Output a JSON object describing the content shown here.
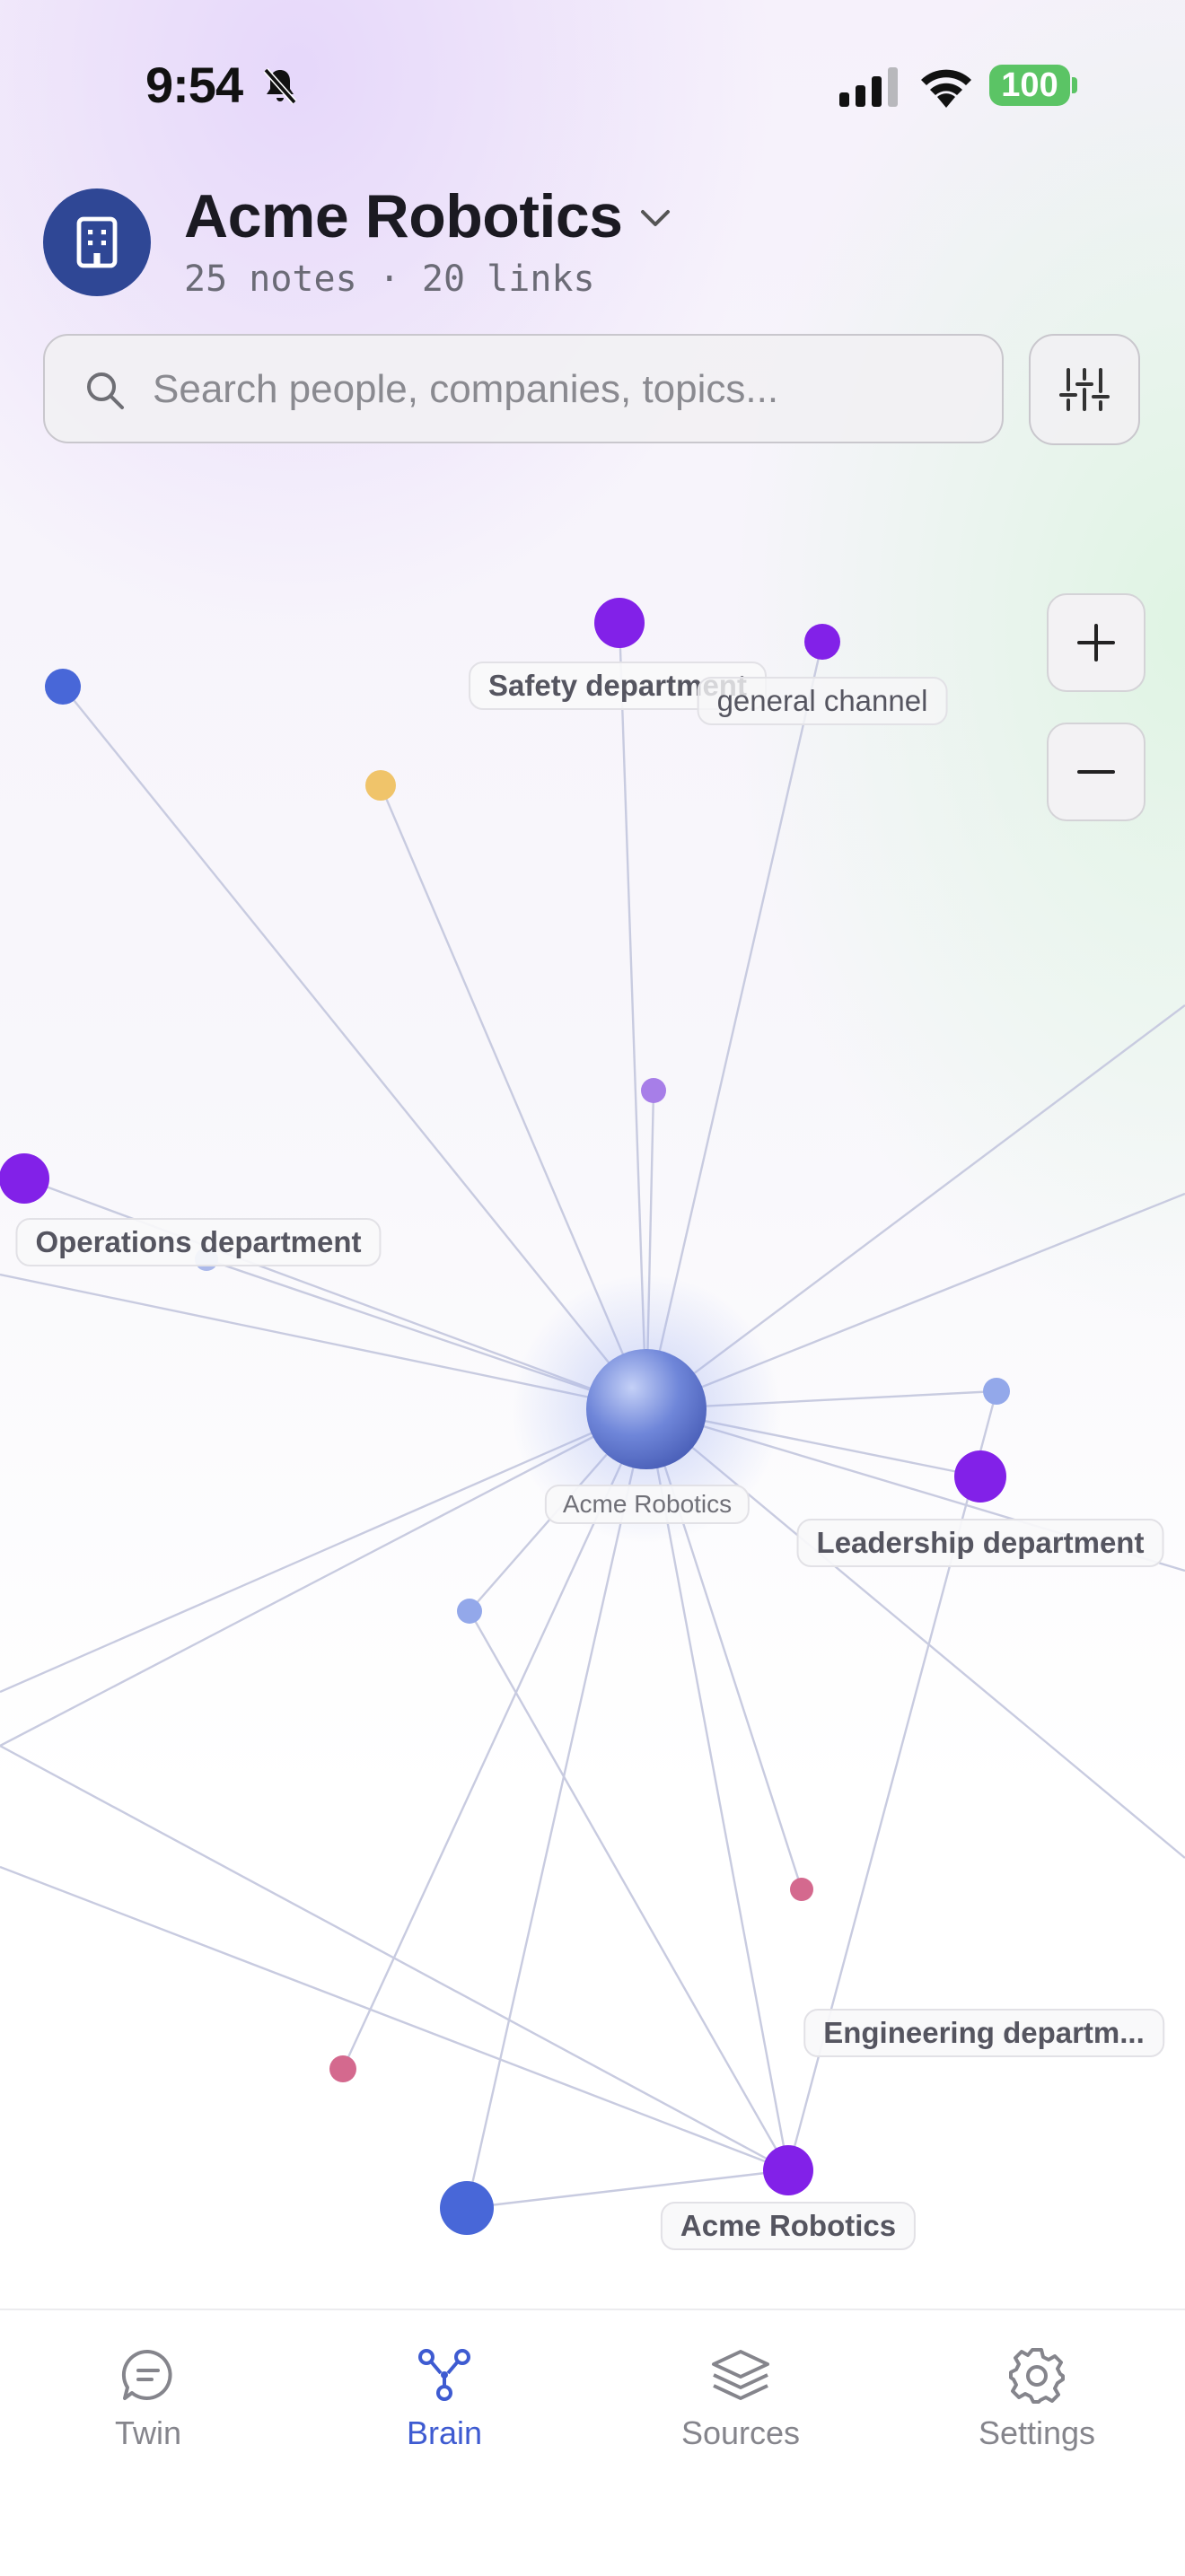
{
  "status_bar": {
    "time": "9:54",
    "battery": "100",
    "icons": [
      "bell-slash-icon",
      "signal-icon",
      "wifi-icon",
      "battery-icon"
    ]
  },
  "header": {
    "title": "Acme Robotics",
    "subtitle": "25 notes · 20 links",
    "avatar_icon": "building-icon",
    "dropdown_icon": "chevron-down-icon"
  },
  "search": {
    "placeholder": "Search people, companies, topics...",
    "value": "",
    "icon": "search-icon",
    "filter_icon": "sliders-icon"
  },
  "zoom": {
    "in_icon": "plus-icon",
    "out_icon": "minus-icon"
  },
  "graph": {
    "labels": {
      "safety": "Safety department",
      "general": "general channel",
      "operations": "Operations department",
      "center": "Acme Robotics",
      "leadership": "Leadership department",
      "engineering": "Engineering departm...",
      "acme_node": "Acme Robotics"
    },
    "colors": {
      "department": "#8221e8",
      "person": "#4867d8",
      "topic": "#f0c46a",
      "doc": "#d4698e",
      "minor": "#aab8ea",
      "edge": "#c9cce0",
      "center": "#6c83d6"
    }
  },
  "tabs": [
    {
      "label": "Twin",
      "icon": "chat-bubble-icon",
      "active": false
    },
    {
      "label": "Brain",
      "icon": "graph-nodes-icon",
      "active": true
    },
    {
      "label": "Sources",
      "icon": "layers-icon",
      "active": false
    },
    {
      "label": "Settings",
      "icon": "gear-icon",
      "active": false
    }
  ]
}
